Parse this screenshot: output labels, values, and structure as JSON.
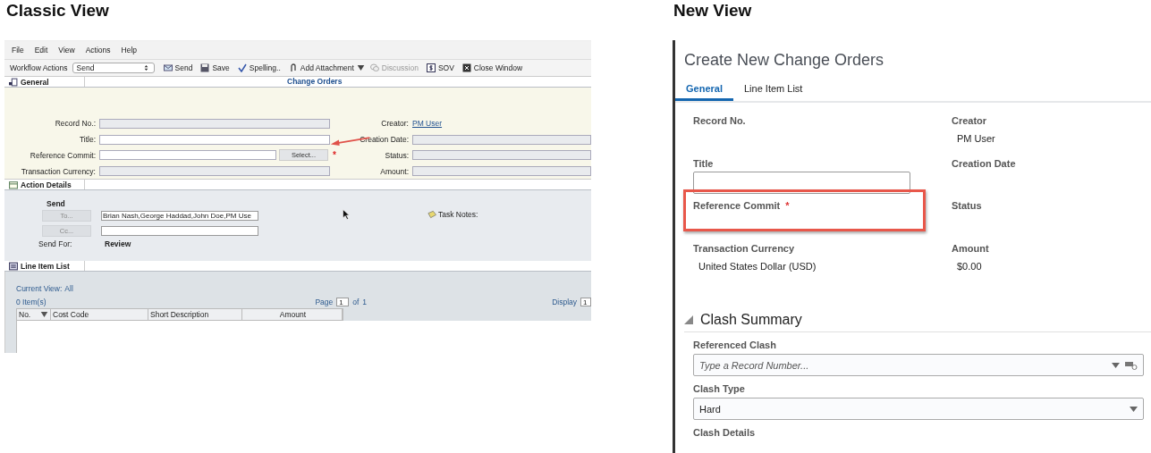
{
  "classic": {
    "heading": "Classic View",
    "menu": [
      "File",
      "Edit",
      "View",
      "Actions",
      "Help"
    ],
    "toolbar": {
      "workflow_label": "Workflow Actions",
      "workflow_value": "Send",
      "buttons": [
        {
          "label": "Send",
          "disabled": false,
          "dropdown": false
        },
        {
          "label": "Save",
          "disabled": false,
          "dropdown": false
        },
        {
          "label": "Spelling..",
          "disabled": false,
          "dropdown": false
        },
        {
          "label": "Add Attachment",
          "disabled": false,
          "dropdown": true
        },
        {
          "label": "Discussion",
          "disabled": true,
          "dropdown": false
        },
        {
          "label": "SOV",
          "disabled": false,
          "dropdown": false
        },
        {
          "label": "Close Window",
          "disabled": false,
          "dropdown": false
        }
      ]
    },
    "form_title": "Change Orders",
    "general": {
      "tab": "General",
      "left_fields": [
        {
          "label": "Record No.:",
          "kind": "readonly"
        },
        {
          "label": "Title:",
          "kind": "input"
        },
        {
          "label": "Reference Commit:",
          "kind": "picker",
          "button": "Select...",
          "required_mark": "*"
        },
        {
          "label": "Transaction Currency:",
          "kind": "readonly"
        }
      ],
      "right_fields": [
        {
          "label": "Creator:",
          "kind": "link",
          "value": "PM User"
        },
        {
          "label": "Creation Date:",
          "kind": "readonly"
        },
        {
          "label": "Status:",
          "kind": "readonly"
        },
        {
          "label": "Amount:",
          "kind": "readonly"
        }
      ]
    },
    "action_details": {
      "tab": "Action Details",
      "heading": "Send",
      "to_button": "To...",
      "to_value": "Brian Nash,George Haddad,John Doe,PM Use",
      "cc_button": "Cc...",
      "send_for_label": "Send For:",
      "send_for_value": "Review",
      "task_notes": "Task Notes:"
    },
    "line_items": {
      "tab": "Line Item List",
      "current_view_label": "Current View:",
      "current_view": "All",
      "count": "0 Item(s)",
      "page_label": "Page",
      "page_value": "1",
      "of_label": "of",
      "page_total": "1",
      "display_label": "Display",
      "display_value": "1",
      "columns": [
        "No.",
        "Cost Code",
        "Short Description",
        "Amount"
      ]
    }
  },
  "new": {
    "heading": "New View",
    "title": "Create New Change Orders",
    "tabs": [
      {
        "label": "General",
        "selected": true
      },
      {
        "label": "Line Item List",
        "selected": false
      }
    ],
    "fields": [
      {
        "label": "Record No.",
        "kind": "text",
        "highlighted": false
      },
      {
        "label": "Creator",
        "kind": "text",
        "value": "PM User",
        "highlighted": false
      },
      {
        "label": "Title",
        "kind": "input",
        "highlighted": false
      },
      {
        "label": "Creation Date",
        "kind": "text",
        "highlighted": false
      },
      {
        "label": "Reference Commit",
        "kind": "text",
        "required_mark": "*",
        "highlighted": true
      },
      {
        "label": "Status",
        "kind": "text",
        "highlighted": false
      },
      {
        "label": "Transaction Currency",
        "kind": "text",
        "value": "United States Dollar (USD)",
        "highlighted": false
      },
      {
        "label": "Amount",
        "kind": "text",
        "value": "$0.00",
        "highlighted": false
      }
    ],
    "section": {
      "title": "Clash Summary",
      "expanded": true,
      "fields": [
        {
          "label": "Referenced Clash",
          "kind": "lookup",
          "placeholder": "Type a Record Number..."
        },
        {
          "label": "Clash Type",
          "kind": "select",
          "value": "Hard"
        },
        {
          "label": "Clash Details",
          "kind": "label"
        }
      ]
    }
  }
}
